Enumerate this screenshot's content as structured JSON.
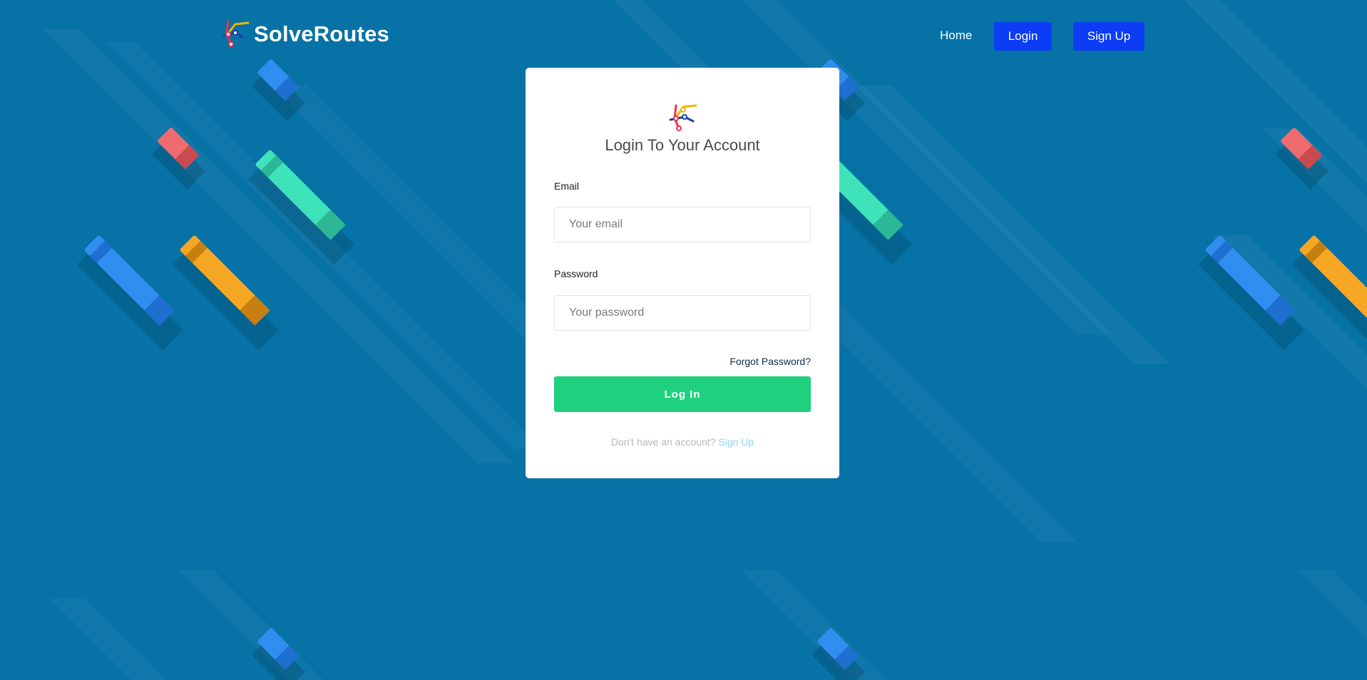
{
  "colors": {
    "background": "#0672a6",
    "nav_button": "#0c3df5",
    "login_button": "#1fd07f",
    "link_dark": "#0b2a52",
    "link_light": "#8dd3f2",
    "marker_blue": "#2f8ef0",
    "marker_red": "#ee6b6e",
    "marker_green": "#3fe3b9",
    "marker_orange": "#f5a623"
  },
  "navbar": {
    "brand_icon": "route-logo-icon",
    "brand_name": "SolveRoutes",
    "home_label": "Home",
    "login_label": "Login",
    "signup_label": "Sign Up"
  },
  "card": {
    "logo_icon": "route-logo-icon",
    "title": "Login To Your Account",
    "email_label": "Email",
    "email_placeholder": "Your email",
    "email_value": "",
    "password_label": "Password",
    "password_placeholder": "Your password",
    "password_value": "",
    "forgot_label": "Forgot Password?",
    "submit_label": "Log In",
    "footer_text": "Don't have an account?",
    "footer_link": "Sign Up"
  }
}
